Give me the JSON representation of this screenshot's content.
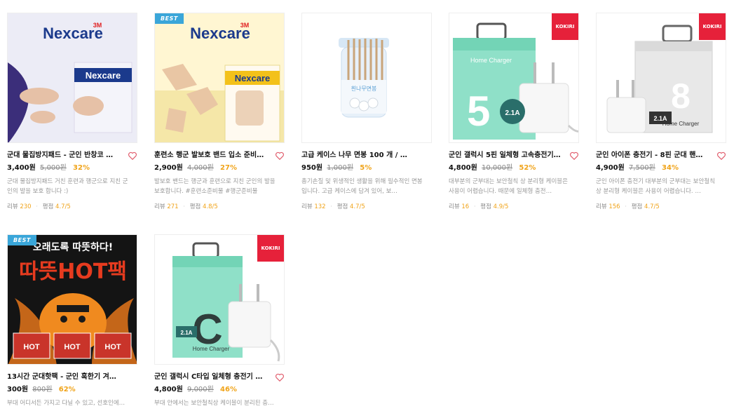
{
  "products": [
    {
      "title": "군대 물집방지패드 - 군인 반창코 …",
      "price": "3,400원",
      "orig_price": "5,000원",
      "discount": "32%",
      "desc": "군대 물집방지패드 거친 훈련과 행군으로 지친 군인의 발을 보호 합니다 :)",
      "review_label": "리뷰",
      "review_count": "230",
      "rating_label": "평점",
      "rating": "4.7/5",
      "badge": "",
      "brand_tag": "",
      "image": {
        "brand": "3M Nexcare",
        "bg": "#e9e7f5",
        "accent": "#1b3a8c"
      }
    },
    {
      "title": "훈련소 행군 발보호 밴드 입소 준비…",
      "price": "2,900원",
      "orig_price": "4,000원",
      "discount": "27%",
      "desc": "발보호 밴드는 행군과 훈련으로 지친 군인의 발을 보호합니다. #훈련소준비물 #행군준비물",
      "review_label": "리뷰",
      "review_count": "271",
      "rating_label": "평점",
      "rating": "4.8/5",
      "badge": "BEST",
      "brand_tag": "",
      "image": {
        "brand": "3M Nexcare",
        "bg": "#fff3c9",
        "accent": "#1b3a8c"
      }
    },
    {
      "title": "고급 케이스 나무 면봉 100 개 / 군…",
      "price": "950원",
      "orig_price": "1,000원",
      "discount": "5%",
      "desc": "총기손질 및 위생적인 생활을 위해 필수적인 면봉 입니다. 고급 케이스에 담겨 있어, 보…",
      "review_label": "리뷰",
      "review_count": "132",
      "rating_label": "평점",
      "rating": "4.7/5",
      "badge": "",
      "brand_tag": "",
      "image": {
        "brand": "흰나무면봉",
        "bg": "#ffffff",
        "accent": "#5a9fd4"
      }
    },
    {
      "title": "군인 갤럭시 5핀 일체형 고속충전기…",
      "price": "4,800원",
      "orig_price": "10,000원",
      "discount": "52%",
      "desc": "대부분의 군부대는 보안철칙 상 분리형 케이블은 사용이 어렵습니다. 때문에 일체형 충전…",
      "review_label": "리뷰",
      "review_count": "16",
      "rating_label": "평점",
      "rating": "4.9/5",
      "badge": "",
      "brand_tag": "KOKIRI",
      "image": {
        "brand": "Home Charger",
        "bg": "#ffffff",
        "accent": "#7fd9c0",
        "big": "5"
      }
    },
    {
      "title": "군인 아이폰 충전기 - 8핀 군대 핸드…",
      "price": "4,900원",
      "orig_price": "7,500원",
      "discount": "34%",
      "desc": "군인 아이폰 충전기 대부분의 군부대는 보안철칙 상 분리형 케이블은 사용이 어렵습니다. …",
      "review_label": "리뷰",
      "review_count": "156",
      "rating_label": "평점",
      "rating": "4.7/5",
      "badge": "",
      "brand_tag": "KOKIRI",
      "image": {
        "brand": "Home Charger",
        "bg": "#ffffff",
        "accent": "#d8d8d8",
        "big": "8"
      }
    },
    {
      "title": "13시간 군대핫팩 - 군인 혹한기 겨…",
      "price": "300원",
      "orig_price": "800원",
      "discount": "62%",
      "desc": "부대 어디서든 가지고 다닐 수 있고, 선호인에…",
      "review_label": "",
      "review_count": "",
      "rating_label": "",
      "rating": "",
      "badge": "BEST",
      "brand_tag": "",
      "image": {
        "brand": "따뜻HOT팩",
        "headline": "오래도록 따뜻하다!",
        "bg": "#1a1a1a",
        "accent": "#e63b1f"
      }
    },
    {
      "title": "군인 갤럭시 C타입 일체형 충전기 …",
      "price": "4,800원",
      "orig_price": "9,000원",
      "discount": "46%",
      "desc": "부대 안에서는 보안철칙상 케이블이 분리된 충…",
      "review_label": "",
      "review_count": "",
      "rating_label": "",
      "rating": "",
      "badge": "",
      "brand_tag": "KOKIRI",
      "image": {
        "brand": "Home Charger",
        "bg": "#ffffff",
        "accent": "#7fd9c0",
        "big": "C"
      }
    }
  ],
  "colors": {
    "discount": "#f0a318",
    "badge_best": "#3aa6d9",
    "badge_kokiri": "#e6213a",
    "heart": "#e05a6a"
  }
}
